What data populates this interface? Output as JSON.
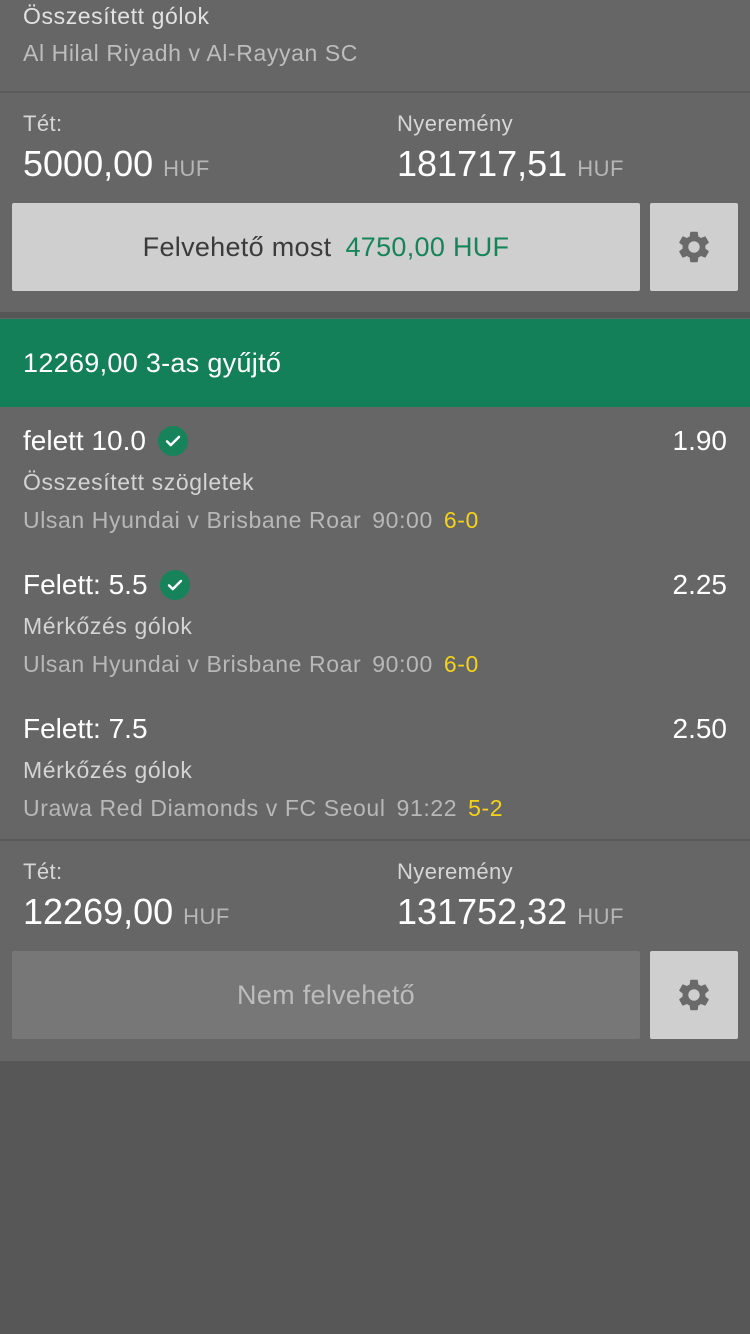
{
  "bet1": {
    "market": "Összesített gólok",
    "event": "Al Hilal Riyadh v Al-Rayyan SC",
    "stake_label": "Tét:",
    "stake_value": "5000,00",
    "stake_currency": "HUF",
    "win_label": "Nyeremény",
    "win_value": "181717,51",
    "win_currency": "HUF",
    "cashout_label": "Felvehető most",
    "cashout_value": "4750,00 HUF",
    "settings_icon": "gear-icon"
  },
  "bet2": {
    "header": "12269,00 3-as gyűjtő",
    "selections": [
      {
        "title": "felett 10.0",
        "won": true,
        "odds": "1.90",
        "market": "Összesített szögletek",
        "event": "Ulsan Hyundai v Brisbane Roar",
        "time": "90:00",
        "score": "6-0"
      },
      {
        "title": "Felett: 5.5",
        "won": true,
        "odds": "2.25",
        "market": "Mérkőzés gólok",
        "event": "Ulsan Hyundai v Brisbane Roar",
        "time": "90:00",
        "score": "6-0"
      },
      {
        "title": "Felett: 7.5",
        "won": false,
        "odds": "2.50",
        "market": "Mérkőzés gólok",
        "event": "Urawa Red Diamonds v FC Seoul",
        "time": "91:22",
        "score": "5-2"
      }
    ],
    "stake_label": "Tét:",
    "stake_value": "12269,00",
    "stake_currency": "HUF",
    "win_label": "Nyeremény",
    "win_value": "131752,32",
    "win_currency": "HUF",
    "cashout_label": "Nem felvehető",
    "settings_icon": "gear-icon"
  },
  "colors": {
    "brand_green": "#148059",
    "cashout_green": "#16845a",
    "score_yellow": "#f5d21a"
  }
}
